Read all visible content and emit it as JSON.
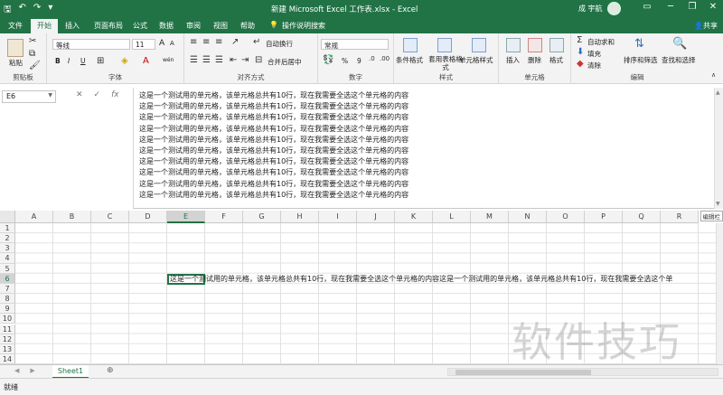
{
  "titlebar": {
    "title": "新建 Microsoft Excel 工作表.xlsx  -  Excel",
    "user": "成 宇航",
    "buttons": [
      "▭",
      "─",
      "❐",
      "✕"
    ]
  },
  "tabs": {
    "items": [
      "文件",
      "开始",
      "插入",
      "页面布局",
      "公式",
      "数据",
      "审阅",
      "视图",
      "帮助",
      "操作说明搜索"
    ],
    "active": "开始",
    "share": "共享"
  },
  "ribbon": {
    "clipboard": {
      "paste": "粘贴",
      "label": "剪贴板"
    },
    "font": {
      "name": "等线",
      "size": "11",
      "label": "字体",
      "bold": "B",
      "italic": "I",
      "underline": "U",
      "grow": "A",
      "shrink": "A",
      "wen": "wén"
    },
    "alignment": {
      "wrap": "自动换行",
      "merge": "合并后居中",
      "label": "对齐方式"
    },
    "number": {
      "format": "常规",
      "percent": "%",
      "comma": "9",
      "label": "数字"
    },
    "styles": {
      "conditional": "条件格式",
      "table": "套用表格格式",
      "cell": "单元格样式",
      "label": "样式"
    },
    "cells": {
      "insert": "插入",
      "delete": "删除",
      "format": "格式",
      "label": "单元格"
    },
    "editing": {
      "autosum": "自动求和",
      "fill": "填充",
      "clear": "清除",
      "sort": "排序和筛选",
      "find": "查找和选择",
      "label": "编辑"
    }
  },
  "formula_bar": {
    "name_box": "E6",
    "cancel": "✕",
    "enter": "✓",
    "fx": "fx",
    "lines": [
      "这是一个测试用的单元格，该单元格总共有10行，现在我需要全选这个单元格的内容",
      "这是一个测试用的单元格，该单元格总共有10行，现在我需要全选这个单元格的内容",
      "这是一个测试用的单元格，该单元格总共有10行，现在我需要全选这个单元格的内容",
      "这是一个测试用的单元格，该单元格总共有10行，现在我需要全选这个单元格的内容",
      "这是一个测试用的单元格，该单元格总共有10行，现在我需要全选这个单元格的内容",
      "这是一个测试用的单元格，该单元格总共有10行，现在我需要全选这个单元格的内容",
      "这是一个测试用的单元格，该单元格总共有10行，现在我需要全选这个单元格的内容",
      "这是一个测试用的单元格，该单元格总共有10行，现在我需要全选这个单元格的内容",
      "这是一个测试用的单元格，该单元格总共有10行，现在我需要全选这个单元格的内容",
      "这是一个测试用的单元格，该单元格总共有10行，现在我需要全选这个单元格的内容"
    ]
  },
  "grid": {
    "columns": [
      "A",
      "B",
      "C",
      "D",
      "E",
      "F",
      "G",
      "H",
      "I",
      "J",
      "K",
      "L",
      "M",
      "N",
      "O",
      "P",
      "Q",
      "R"
    ],
    "rows": [
      "1",
      "2",
      "3",
      "4",
      "5",
      "6",
      "7",
      "8",
      "9",
      "10",
      "11",
      "12",
      "13",
      "14"
    ],
    "active_col": "E",
    "active_row": "6",
    "active_cell_text": "这是一个测试用的单元格，该单元格总共有10行，现在我需要全选这个单元格的内容这是一个测试用的单元格，该单元格总共有10行，现在我需要全选这个单",
    "edit_hint": "编辑栏"
  },
  "sheets": {
    "tabs": [
      "Sheet1"
    ],
    "add": "⊕"
  },
  "status": {
    "text": "就绪"
  },
  "watermark": "软件技巧"
}
